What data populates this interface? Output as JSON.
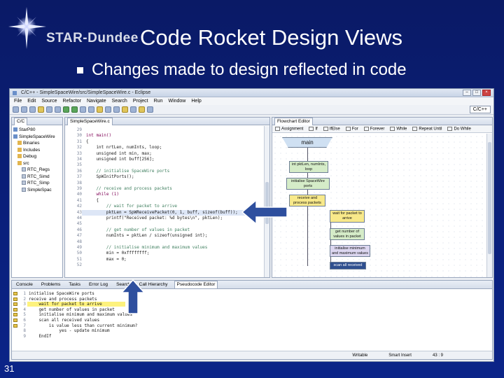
{
  "slide": {
    "logo_text": "STAR-Dundee",
    "title": "Code Rocket Design Views",
    "bullet": "Changes made to design reflected in code",
    "page_number": "31"
  },
  "window": {
    "title": "C/C++ - SimpleSpaceWire/src/SimpleSpaceWire.c - Eclipse",
    "menu": [
      "File",
      "Edit",
      "Source",
      "Refactor",
      "Navigate",
      "Search",
      "Project",
      "Run",
      "Window",
      "Help"
    ],
    "perspective": "C/C++"
  },
  "explorer": {
    "tab": "C/C",
    "items": [
      {
        "label": "StarP80",
        "icon": "project-icon",
        "indent": 0
      },
      {
        "label": "SimpleSpaceWire",
        "icon": "project-icon",
        "indent": 0
      },
      {
        "label": "Binaries",
        "icon": "folder-icon",
        "indent": 1
      },
      {
        "label": "Includes",
        "icon": "folder-icon",
        "indent": 1
      },
      {
        "label": "Debug",
        "icon": "folder-icon",
        "indent": 1
      },
      {
        "label": "src",
        "icon": "folder-icon",
        "indent": 1
      },
      {
        "label": "RTC_Regs",
        "icon": "file-icon",
        "indent": 2
      },
      {
        "label": "RTC_Simd",
        "icon": "file-icon",
        "indent": 2
      },
      {
        "label": "RTC_Simp",
        "icon": "file-icon",
        "indent": 2
      },
      {
        "label": "SimpleSpac",
        "icon": "file-icon",
        "indent": 2
      }
    ]
  },
  "editor": {
    "tab": "SimpleSpaceWire.c",
    "lines": [
      {
        "n": "29",
        "t": "",
        "c": ""
      },
      {
        "n": "30",
        "t": "int main()",
        "c": "kw"
      },
      {
        "n": "31",
        "t": "{",
        "c": ""
      },
      {
        "n": "32",
        "t": "    int nrtLen, numInts, loop;",
        "c": ""
      },
      {
        "n": "33",
        "t": "    unsigned int min, max;",
        "c": ""
      },
      {
        "n": "34",
        "t": "    unsigned int buff[256];",
        "c": ""
      },
      {
        "n": "35",
        "t": "",
        "c": ""
      },
      {
        "n": "36",
        "t": "    // initialise SpaceWire ports",
        "c": "cmt"
      },
      {
        "n": "37",
        "t": "    SpWInitPorts();",
        "c": ""
      },
      {
        "n": "38",
        "t": "",
        "c": ""
      },
      {
        "n": "39",
        "t": "    // receive and process packets",
        "c": "cmt"
      },
      {
        "n": "40",
        "t": "    while (1)",
        "c": "kw"
      },
      {
        "n": "41",
        "t": "    {",
        "c": ""
      },
      {
        "n": "42",
        "t": "        // wait for packet to arrive",
        "c": "cmt"
      },
      {
        "n": "43",
        "t": "        pktLen = SpWReceivePacket(0, 1, buff, sizeof(buff));",
        "c": ""
      },
      {
        "n": "44",
        "t": "        printf(\"Received packet: %d bytes\\n\", pktLen);",
        "c": ""
      },
      {
        "n": "45",
        "t": "",
        "c": ""
      },
      {
        "n": "46",
        "t": "        // get number of values in packet",
        "c": "cmt"
      },
      {
        "n": "47",
        "t": "        numInts = pktLen / sizeof(unsigned int);",
        "c": ""
      },
      {
        "n": "48",
        "t": "",
        "c": ""
      },
      {
        "n": "49",
        "t": "        // initialise minimum and maximum values",
        "c": "cmt"
      },
      {
        "n": "50",
        "t": "        min = 0xffffffff;",
        "c": ""
      },
      {
        "n": "51",
        "t": "        max = 0;",
        "c": ""
      },
      {
        "n": "52",
        "t": "",
        "c": ""
      }
    ]
  },
  "flowchart": {
    "tab": "Flowchart Editor",
    "palette": [
      "Assignment",
      "If",
      "IfElse",
      "For",
      "Forever",
      "While",
      "Repeat Until",
      "Do While"
    ],
    "nodes": [
      {
        "name": "main-node",
        "label": "main",
        "style": "blue"
      },
      {
        "name": "declaration-node",
        "label": "int pktLen, numInts, loop",
        "style": "green"
      },
      {
        "name": "init-ports-node",
        "label": "initialise SpaceWire ports",
        "style": "green"
      },
      {
        "name": "receive-process-node",
        "label": "receive and process packets",
        "style": "yellow"
      },
      {
        "name": "wait-packet-node",
        "label": "wait for packet to arrive",
        "style": "yellow"
      },
      {
        "name": "get-number-node",
        "label": "get number of values in packet",
        "style": "green"
      },
      {
        "name": "init-minmax-node",
        "label": "initialise minimum and maximum values",
        "style": "lav"
      },
      {
        "name": "scan-values-node",
        "label": "scan all received",
        "style": "sel"
      }
    ]
  },
  "bottom": {
    "tabs": [
      "Console",
      "Problems",
      "Tasks",
      "Error Log",
      "Search",
      "Call Hierarchy",
      "Pseudocode Editor"
    ],
    "pseudocode": [
      {
        "n": "1",
        "t": "initialise SpaceWire ports",
        "hl": false
      },
      {
        "n": "2",
        "t": "receive and process packets",
        "hl": false
      },
      {
        "n": "3",
        "t": "    wait for packet to arrive",
        "hl": true
      },
      {
        "n": "4",
        "t": "    get number of values in packet",
        "hl": false
      },
      {
        "n": "5",
        "t": "    initialise minimum and maximum values",
        "hl": false
      },
      {
        "n": "6",
        "t": "    scan all received values",
        "hl": false
      },
      {
        "n": "7",
        "t": "        is value less than current minimum?",
        "hl": false
      },
      {
        "n": "8",
        "t": "            yes - update minimum",
        "hl": false
      },
      {
        "n": "9",
        "t": "    EndIf",
        "hl": false
      }
    ],
    "status": {
      "mode": "Writable",
      "insert": "Smart Insert",
      "position": "43 : 9"
    }
  },
  "colors": {
    "arrow": "#2e4f9e",
    "slide_bg": "#0a1f7a"
  }
}
